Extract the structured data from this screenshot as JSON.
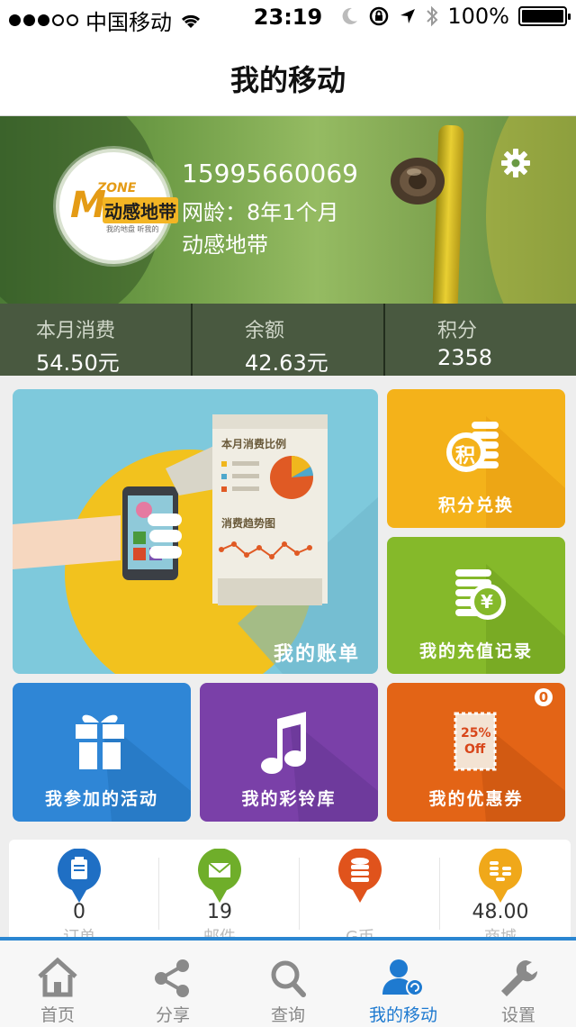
{
  "status_bar": {
    "carrier": "中国移动",
    "time": "23:19",
    "battery": "100%"
  },
  "nav": {
    "title": "我的移动"
  },
  "profile": {
    "avatar_logo": {
      "m": "M",
      "zone": "ZONE",
      "cn": "动感地带",
      "sub": "我的地盘 听我的"
    },
    "phone": "15995660069",
    "network_age": "网龄：8年1个月",
    "brand": "动感地带"
  },
  "stats": [
    {
      "label": "本月消费",
      "value": "54.50元"
    },
    {
      "label": "余额",
      "value": "42.63元"
    },
    {
      "label": "积分",
      "value": "2358"
    }
  ],
  "tiles": {
    "bill": {
      "label": "我的账单",
      "doc_title": "本月消费比例",
      "doc_trend": "消费趋势图"
    },
    "points": {
      "label": "积分兑换",
      "icon_char": "积"
    },
    "recharge": {
      "label": "我的充值记录",
      "icon_char": "¥"
    },
    "activity": {
      "label": "我参加的活动"
    },
    "ringtone": {
      "label": "我的彩铃库"
    },
    "coupon": {
      "label": "我的优惠券",
      "badge": "0",
      "ticket_top": "25%",
      "ticket_bottom": "Off"
    }
  },
  "shortcuts": [
    {
      "value": "0",
      "label": "订单",
      "color": "#1f6fc4",
      "icon": "clipboard-icon"
    },
    {
      "value": "19",
      "label": "邮件",
      "color": "#6fae2a",
      "icon": "mail-icon"
    },
    {
      "value": "",
      "label": "G币",
      "color": "#e0531c",
      "icon": "coin-stack-icon"
    },
    {
      "value": "48.00",
      "label": "商城",
      "color": "#f0a81a",
      "icon": "coins-icon"
    }
  ],
  "tabs": [
    {
      "label": "首页",
      "icon": "home-icon"
    },
    {
      "label": "分享",
      "icon": "share-icon"
    },
    {
      "label": "查询",
      "icon": "search-icon"
    },
    {
      "label": "我的移动",
      "icon": "user-icon",
      "active": true
    },
    {
      "label": "设置",
      "icon": "wrench-icon"
    }
  ]
}
